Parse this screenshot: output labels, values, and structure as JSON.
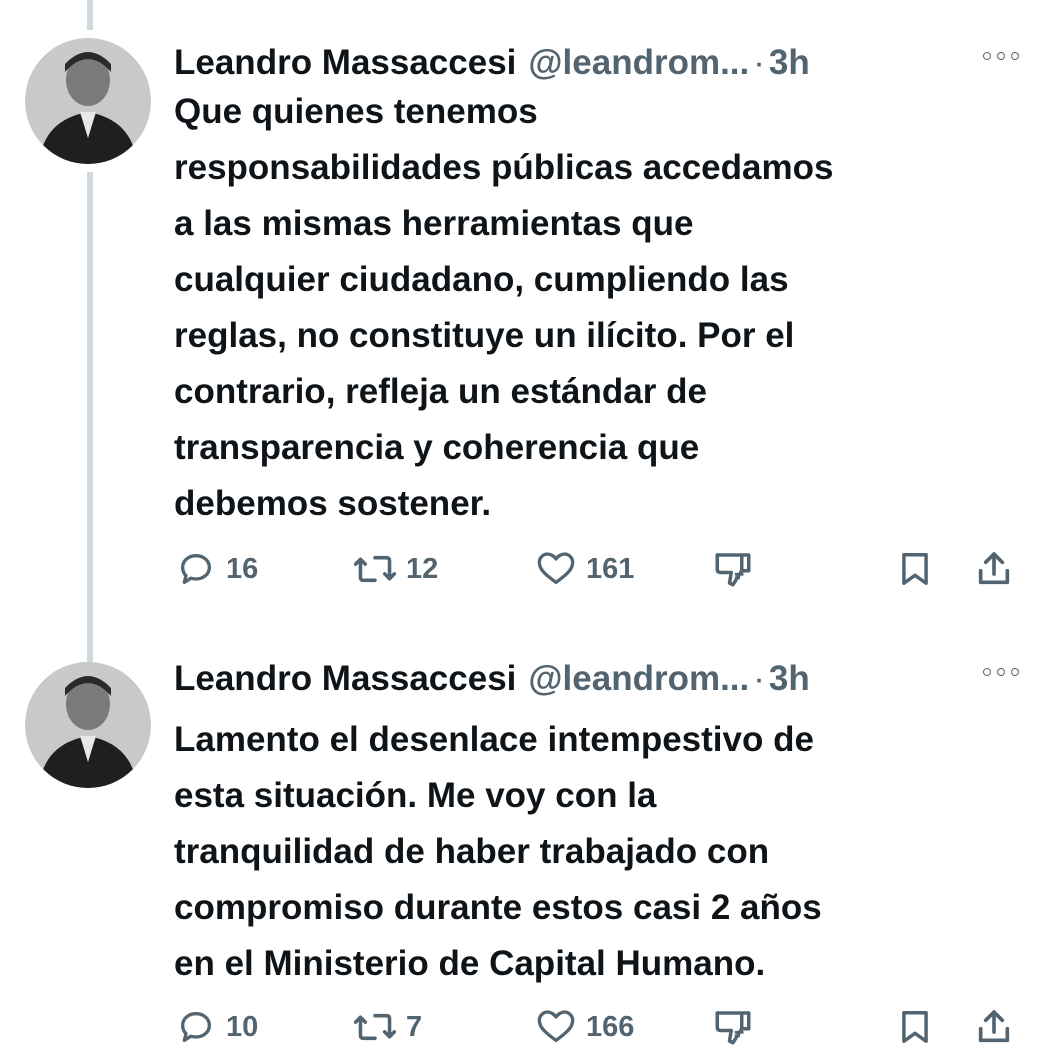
{
  "tweets": [
    {
      "name": "Leandro Massaccesi",
      "handle": "@leandrom...",
      "separator": "·",
      "time": "3h",
      "text_lines": [
        "Que quienes tenemos",
        "responsabilidades públicas accedamos",
        "a las mismas herramientas que",
        "cualquier ciudadano, cumpliendo las",
        "reglas, no constituye un ilícito. Por el",
        "contrario, refleja un estándar de",
        "transparencia y coherencia que",
        "debemos sostener."
      ],
      "replies": "16",
      "retweets": "12",
      "likes": "161"
    },
    {
      "name": "Leandro Massaccesi",
      "handle": "@leandrom...",
      "separator": "·",
      "time": "3h",
      "text_lines": [
        "Lamento el desenlace intempestivo de",
        "esta situación. Me voy con la",
        "tranquilidad de haber trabajado con",
        "compromiso durante estos casi 2 años",
        "en el Ministerio de Capital Humano."
      ],
      "replies": "10",
      "retweets": "7",
      "likes": "166"
    }
  ],
  "icons": {
    "reply": "reply-icon",
    "retweet": "retweet-icon",
    "like": "like-icon",
    "dislike": "dislike-icon",
    "bookmark": "bookmark-icon",
    "share": "share-icon",
    "more": "more-icon"
  },
  "colors": {
    "text": "#0f1419",
    "secondary": "#536471",
    "thread_line": "#cfd9de",
    "background": "#ffffff"
  }
}
